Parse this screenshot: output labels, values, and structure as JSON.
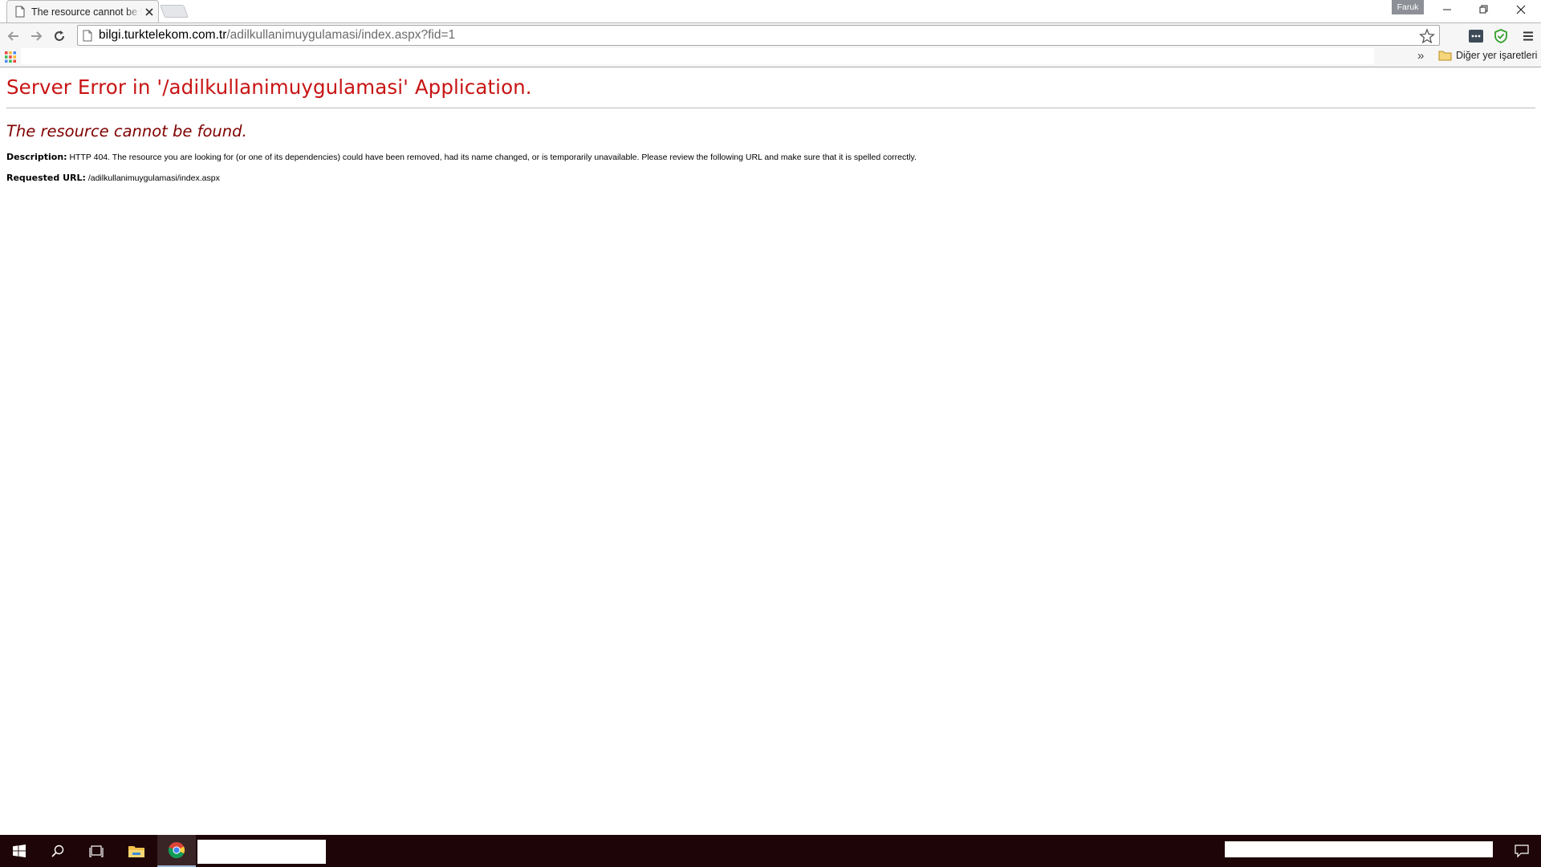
{
  "browser": {
    "tab": {
      "title": "The resource cannot be found - Google Chrome"
    },
    "profile_name": "Faruk",
    "address": {
      "host": "bilgi.turktelekom.com.tr",
      "path": "/adilkullanimuygulamasi/index.aspx?fid=1"
    },
    "bookmarks": {
      "overflow_label": "»",
      "other_bookmarks_label": "Diğer yer işaretleri"
    }
  },
  "page": {
    "server_error_title": "Server Error in '/adilkullanimuygulamasi' Application.",
    "error_heading": "The resource cannot be found.",
    "description_label": "Description:",
    "description_text": "HTTP 404. The resource you are looking for (or one of its dependencies) could have been removed, had its name changed, or is temporarily unavailable.  Please review the following URL and make sure that it is spelled correctly.",
    "requested_url_label": "Requested URL:",
    "requested_url_value": "/adilkullanimuygulamasi/index.aspx"
  },
  "colors": {
    "error_title": "#c81414",
    "error_heading": "#800000",
    "taskbar": "#1e0507"
  },
  "icons": {
    "tab": "page-icon",
    "toolbar": [
      "back-arrow-icon",
      "forward-arrow-icon",
      "reload-icon",
      "star-icon",
      "extension-icon",
      "shield-check-icon",
      "menu-icon"
    ],
    "taskbar": [
      "windows-start-icon",
      "search-icon",
      "task-view-icon",
      "file-explorer-icon",
      "chrome-icon",
      "notifications-icon"
    ]
  }
}
